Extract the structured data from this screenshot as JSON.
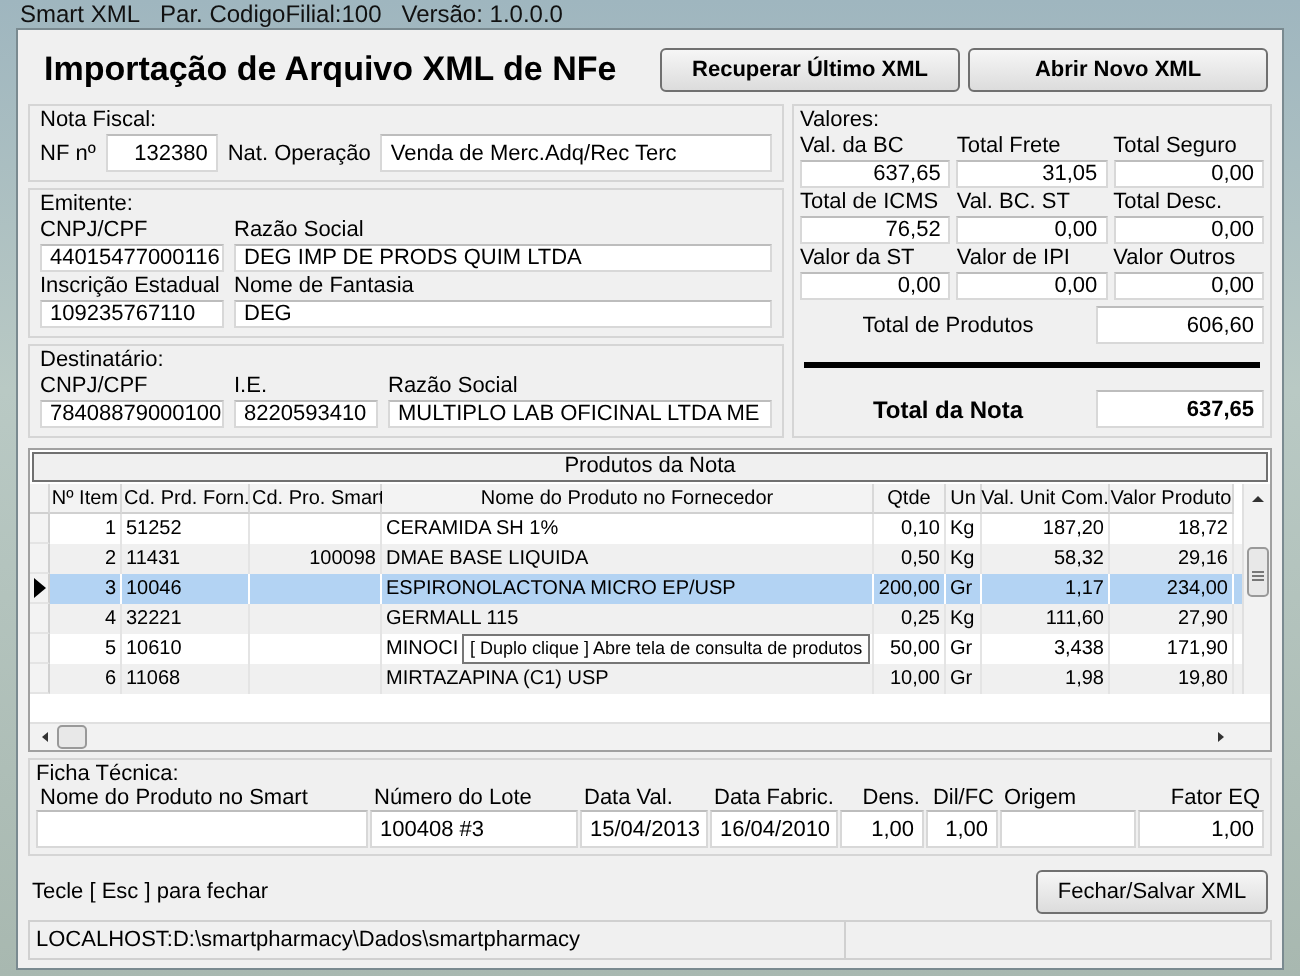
{
  "window": {
    "title_parts": [
      "Smart XML",
      "Par. CodigoFilial:100",
      "Versão: 1.0.0.0"
    ]
  },
  "header": {
    "title": "Importação de Arquivo XML de NFe",
    "buttons": [
      "Recuperar Último XML",
      "Abrir Novo XML"
    ]
  },
  "nota_fiscal": {
    "legend": "Nota Fiscal:",
    "nf_label": "NF nº",
    "nf_value": "132380",
    "nat_label": "Nat. Operação",
    "nat_value": "Venda de Merc.Adq/Rec Terc"
  },
  "emitente": {
    "legend": "Emitente:",
    "rows": [
      [
        {
          "label": "CNPJ/CPF",
          "value": "44015477000116"
        },
        {
          "label": "Razão Social",
          "value": "DEG IMP DE PRODS QUIM LTDA"
        }
      ],
      [
        {
          "label": "Inscrição Estadual",
          "value": "109235767110"
        },
        {
          "label": "Nome de Fantasia",
          "value": "DEG"
        }
      ]
    ]
  },
  "destinatario": {
    "legend": "Destinatário:",
    "fields": [
      {
        "label": "CNPJ/CPF",
        "value": "78408879000100"
      },
      {
        "label": "I.E.",
        "value": "8220593410"
      },
      {
        "label": "Razão Social",
        "value": "MULTIPLO LAB OFICINAL LTDA ME"
      }
    ]
  },
  "valores": {
    "legend": "Valores:",
    "fields": [
      {
        "label": "Val. da BC",
        "value": "637,65"
      },
      {
        "label": "Total Frete",
        "value": "31,05"
      },
      {
        "label": "Total Seguro",
        "value": "0,00"
      },
      {
        "label": "Total de ICMS",
        "value": "76,52"
      },
      {
        "label": "Val. BC. ST",
        "value": "0,00"
      },
      {
        "label": "Total Desc.",
        "value": "0,00"
      },
      {
        "label": "Valor da ST",
        "value": "0,00"
      },
      {
        "label": "Valor de IPI",
        "value": "0,00"
      },
      {
        "label": "Valor Outros",
        "value": "0,00"
      }
    ],
    "total_produtos": {
      "label": "Total de Produtos",
      "value": "606,60"
    },
    "total_nota": {
      "label": "Total da Nota",
      "value": "637,65"
    }
  },
  "table": {
    "title": "Produtos da Nota",
    "columns": [
      "Nº Item",
      "Cd. Prd. Forn.",
      "Cd. Pro. Smart",
      "Nome do Produto no Fornecedor",
      "Qtde",
      "Un",
      "Val. Unit Com.",
      "Valor Produto"
    ],
    "rows": [
      {
        "cells": [
          "1",
          "51252",
          "",
          "CERAMIDA SH 1%",
          "0,10",
          "Kg",
          "187,20",
          "18,72"
        ],
        "selected": false
      },
      {
        "cells": [
          "2",
          "11431",
          "100098",
          "DMAE BASE LIQUIDA",
          "0,50",
          "Kg",
          "58,32",
          "29,16"
        ],
        "selected": false
      },
      {
        "cells": [
          "3",
          "10046",
          "",
          "ESPIRONOLACTONA MICRO EP/USP",
          "200,00",
          "Gr",
          "1,17",
          "234,00"
        ],
        "selected": true
      },
      {
        "cells": [
          "4",
          "32221",
          "",
          "GERMALL 115",
          "0,25",
          "Kg",
          "111,60",
          "27,90"
        ],
        "selected": false
      },
      {
        "cells": [
          "5",
          "10610",
          "",
          "MINOCI",
          "50,00",
          "Gr",
          "3,438",
          "171,90"
        ],
        "selected": false
      },
      {
        "cells": [
          "6",
          "11068",
          "",
          "MIRTAZAPINA (C1) USP",
          "10,00",
          "Gr",
          "1,98",
          "19,80"
        ],
        "selected": false
      }
    ],
    "tooltip": "[ Duplo clique ] Abre tela de consulta de produtos"
  },
  "ficha_tecnica": {
    "legend": "Ficha Técnica:",
    "fields": [
      {
        "label": "Nome do Produto no Smart",
        "kind": "text"
      },
      {
        "label": "Número do Lote",
        "value": "100408    #3",
        "kind": "text"
      },
      {
        "label": "Data Val.",
        "value": "15/04/2013",
        "kind": "text"
      },
      {
        "label": "Data Fabric.",
        "value": "16/04/2010",
        "kind": "text"
      },
      {
        "label": "Dens.",
        "value": "1,00",
        "kind": "number"
      },
      {
        "label": "Dil/FC",
        "value": "1,00",
        "kind": "number"
      },
      {
        "label": "Origem",
        "kind": "text"
      },
      {
        "label": "Fator EQ",
        "value": "1,00",
        "kind": "number"
      }
    ]
  },
  "footer": {
    "hint": "Tecle [ Esc ] para fechar",
    "button": "Fechar/Salvar XML"
  },
  "status_bar": {
    "path": "LOCALHOST:D:\\smartpharmacy\\Dados\\smartpharmacy"
  }
}
